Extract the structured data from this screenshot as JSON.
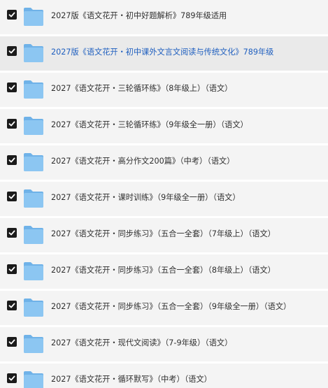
{
  "colors": {
    "row_background": "#f4f4f4",
    "row_hover_background": "#eaeaea",
    "text": "#2f2f2f",
    "link_hover_text": "#1f5fbf",
    "checkbox": "#1b1b1b",
    "folder_front": "#8cc6f2",
    "folder_back": "#6fb2e8"
  },
  "items": [
    {
      "label": "2027版《语文花开・初中好题解析》789年级适用",
      "checked": true,
      "icon": "folder-icon"
    },
    {
      "label": "2027版《语文花开・初中课外文言文阅读与传统文化》789年级",
      "checked": true,
      "icon": "folder-icon",
      "highlighted": true
    },
    {
      "label": "2027《语文花开・三轮循环练》（8年级上）（语文）",
      "checked": true,
      "icon": "folder-icon"
    },
    {
      "label": "2027《语文花开・三轮循环练》（9年级全一册）（语文）",
      "checked": true,
      "icon": "folder-icon"
    },
    {
      "label": "2027《语文花开・高分作文200篇》（中考）（语文）",
      "checked": true,
      "icon": "folder-icon"
    },
    {
      "label": "2027《语文花开・课时训练》（9年级全一册）（语文）",
      "checked": true,
      "icon": "folder-icon"
    },
    {
      "label": "2027《语文花开・同步练习》（五合一全套）（7年级上）（语文）",
      "checked": true,
      "icon": "folder-icon"
    },
    {
      "label": "2027《语文花开・同步练习》（五合一全套）（8年级上）（语文）",
      "checked": true,
      "icon": "folder-icon"
    },
    {
      "label": "2027《语文花开・同步练习》（五合一全套）（9年级全一册）（语文）",
      "checked": true,
      "icon": "folder-icon"
    },
    {
      "label": "2027《语文花开・现代文阅读》（7-9年级）（语文）",
      "checked": true,
      "icon": "folder-icon"
    },
    {
      "label": "2027《语文花开・循环默写》（中考）（语文）",
      "checked": true,
      "icon": "folder-icon"
    }
  ]
}
